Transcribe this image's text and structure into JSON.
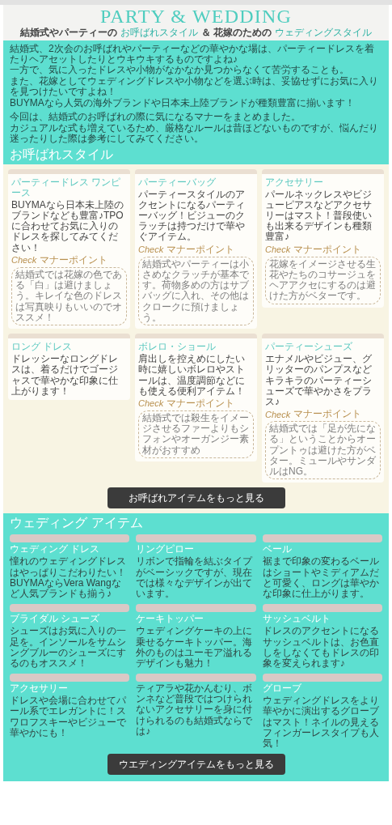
{
  "header": {
    "title": "PARTY & WEDDING",
    "subtitle": [
      {
        "text": "結婚式やパーティーの",
        "accent": false
      },
      {
        "text": "お呼ばれスタイル",
        "accent": true
      },
      {
        "text": "＆ 花嫁のための",
        "accent": false
      },
      {
        "text": "ウェディングスタイル",
        "accent": true
      }
    ]
  },
  "intro": {
    "paragraphs": [
      [
        "結婚式、2次会のお呼ばれやパーティーなどの華やかな場は、パーティードレスを着たりヘアセットしたりとウキウキするものですよね♪",
        "一方で、気に入ったドレスや小物がなかなか見つからなくて苦労することも。",
        "また、花嫁としてウェディングドレスや小物などを選ぶ時は、妥協せずにお気に入りを見つけたいですよね！",
        "BUYMAなら人気の海外ブランドや日本未上陸ブランドが種類豊富に揃います！"
      ],
      [
        "今回は、結婚式のお呼ばれの際に気になるマナーをまとめました。",
        "カジュアルな式も増えているため、厳格なルールは昔ほどないものですが、悩んだり迷ったりした際は参考にしてみてください。"
      ]
    ]
  },
  "guest_section": {
    "title": "お呼ばれスタイル",
    "items": [
      {
        "title": "パーティードレス ワンピース",
        "text": "BUYMAなら日本未上陸のブランドなども豊富♪TPOに合わせてお気に入りのドレスを探してみてください！",
        "check": {
          "tag": "Check",
          "label": "マナーポイント",
          "text": "結婚式では花嫁の色である「白」は避けましょう。キレイな色のドレスは写真映りもいいのでオススメ！"
        }
      },
      {
        "title": "パーティーバッグ",
        "text": "パーティースタイルのアクセントになるパーティーバッグ！ビジューのクラッチは持つだけで華やぐアイテム。",
        "check": {
          "tag": "Check",
          "label": "マナーポイント",
          "text": "結婚式やパーティーは小さめなクラッチが基本です。荷物多めの方はサブバッグに入れ、その他はクロークに預けましょう。"
        }
      },
      {
        "title": "アクセサリー",
        "text": "パールネックレスやビジューピアスなどアクセサリーはマスト！普段使いも出来るデザインも種類豊富♪",
        "check": {
          "tag": "Check",
          "label": "マナーポイント",
          "text": "花嫁をイメージさせる生花やたちのコサージュをヘアアクセにするのは避けた方がベターです。"
        }
      },
      {
        "title": "ロング ドレス",
        "text": "ドレッシーなロングドレスは、着るだけでゴージャスで華やかな印象に仕上がります！"
      },
      {
        "title": "ボレロ・ショール",
        "text": "肩出しを控えめにしたい時に嬉しいボレロやストールは、温度調節などにも使える便利アイテム！",
        "check": {
          "tag": "Check",
          "label": "マナーポイント",
          "text": "結婚式では殺生をイメージさせるファーよりもシフォンやオーガンジー素材がおすすめ"
        }
      },
      {
        "title": "パーティーシューズ",
        "text": "エナメルやビジュー、グリッターのパンプスなどキラキラのパーティーシューズで華やかさをプラス♪",
        "check": {
          "tag": "Check",
          "label": "マナーポイント",
          "text": "結婚式では「足が先になる」ということからオープントゥは避けた方がベター。ミュールやサンダルはNG。"
        }
      }
    ],
    "button": "お呼ばれアイテムをもっと見る"
  },
  "wedding_section": {
    "title": "ウェディング アイテム",
    "items": [
      {
        "title": "ウェディング ドレス",
        "text": "憧れのウェディングドレスはやっぱりこだわりたい！BUYMAならVera Wangなど人気ブランドも揃う♪"
      },
      {
        "title": "リングピロー",
        "text": "リボンで指輪を結ぶタイプがベーシックですが、現在では様々なデザインが出ています。"
      },
      {
        "title": "ベール",
        "text": "裾まで印象の変わるベールはショートやミディアムだと可愛く、ロングは華やかな印象に仕上がります。"
      },
      {
        "title": "ブライダル シューズ",
        "text": "シューズはお気に入りの一足を。インソールをサムシングブルーのシューズにするのもオススメ！"
      },
      {
        "title": "ケーキトッパー",
        "text": "ウェディングケーキの上に乗せるケーキトッパー。海外のものはユーモア溢れるデザインも魅力！"
      },
      {
        "title": "サッシュベルト",
        "text": "ドレスのアクセントになるサッシュベルトは、お色直しをしなくてもドレスの印象を変えられます♪"
      },
      {
        "title": "アクセサリー",
        "text": "ドレスや会場に合わせてパール系でエレガントに！スワロフスキーやビジューで華やかにも！"
      },
      {
        "text": "ティアラや花かんむり、ボンネなど普段ではつけられないアクセサリーを身に付けられるのも結婚式ならでは♪"
      },
      {
        "title": "グローブ",
        "text": "ウェディングドレスをより華やかに演出するグローブはマスト！ネイルの見えるフィンガーレスタイプも人気！"
      }
    ],
    "button": "ウエディングアイテムをもっと見る"
  }
}
